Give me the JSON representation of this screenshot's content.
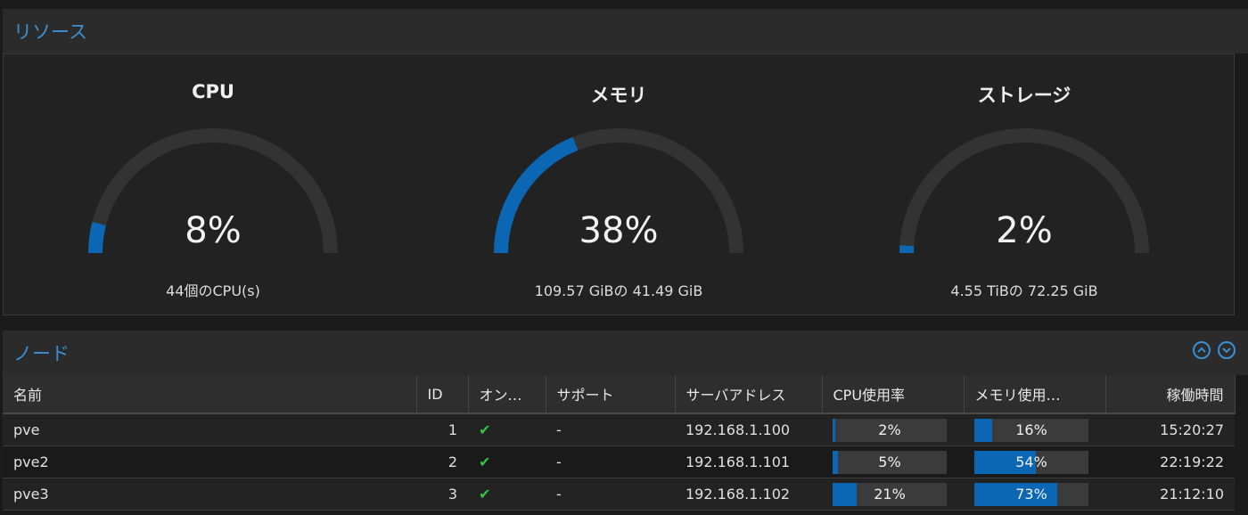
{
  "resources": {
    "title": "リソース",
    "gauges": [
      {
        "title": "CPU",
        "value_text": "8%",
        "fraction": 0.08,
        "subtitle": "44個のCPU(s)"
      },
      {
        "title": "メモリ",
        "value_text": "38%",
        "fraction": 0.38,
        "subtitle": "109.57 GiBの 41.49 GiB"
      },
      {
        "title": "ストレージ",
        "value_text": "2%",
        "fraction": 0.02,
        "subtitle": "4.55 TiBの 72.25 GiB"
      }
    ]
  },
  "nodes": {
    "title": "ノード",
    "columns": [
      "名前",
      "ID",
      "オン…",
      "サポート",
      "サーバアドレス",
      "CPU使用率",
      "メモリ使用…",
      "稼働時間"
    ],
    "rows": [
      {
        "name": "pve",
        "id": "1",
        "support": "-",
        "address": "192.168.1.100",
        "cpu_text": "2%",
        "cpu": 0.02,
        "mem_text": "16%",
        "mem": 0.16,
        "uptime": "15:20:27"
      },
      {
        "name": "pve2",
        "id": "2",
        "support": "-",
        "address": "192.168.1.101",
        "cpu_text": "5%",
        "cpu": 0.05,
        "mem_text": "54%",
        "mem": 0.54,
        "uptime": "22:19:22"
      },
      {
        "name": "pve3",
        "id": "3",
        "support": "-",
        "address": "192.168.1.102",
        "cpu_text": "21%",
        "cpu": 0.21,
        "mem_text": "73%",
        "mem": 0.73,
        "uptime": "21:12:10"
      }
    ]
  },
  "colors": {
    "accent": "#3b8fd4",
    "bar_fill": "#0b66b3",
    "gauge_track": "#333333",
    "online": "#35c24a"
  }
}
